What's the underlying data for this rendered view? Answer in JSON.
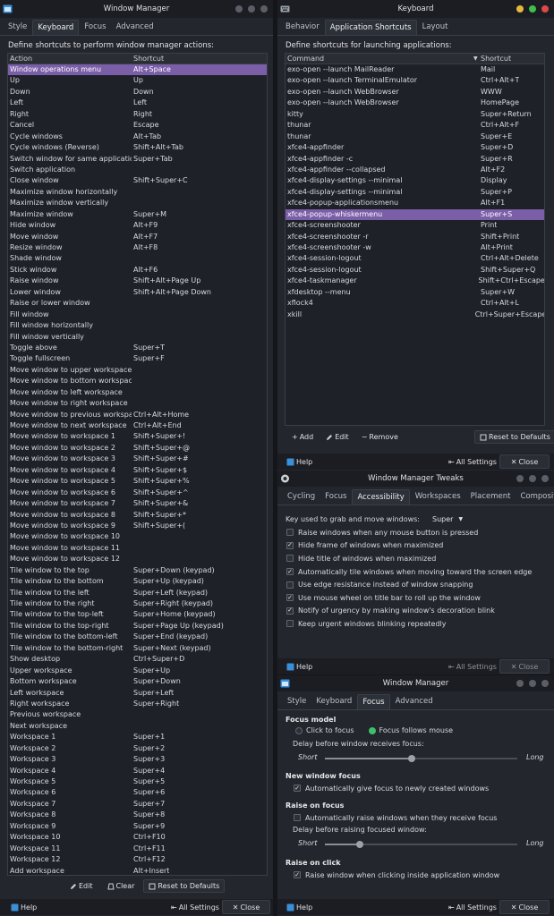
{
  "wm1": {
    "title": "Window Manager",
    "tabs": [
      "Style",
      "Keyboard",
      "Focus",
      "Advanced"
    ],
    "active_tab": 1,
    "description": "Define shortcuts to perform window manager actions:",
    "col_action": "Action",
    "col_shortcut": "Shortcut",
    "rows": [
      [
        "Window operations menu",
        "Alt+Space"
      ],
      [
        "Up",
        "Up"
      ],
      [
        "Down",
        "Down"
      ],
      [
        "Left",
        "Left"
      ],
      [
        "Right",
        "Right"
      ],
      [
        "Cancel",
        "Escape"
      ],
      [
        "Cycle windows",
        "Alt+Tab"
      ],
      [
        "Cycle windows (Reverse)",
        "Shift+Alt+Tab"
      ],
      [
        "Switch window for same application",
        "Super+Tab"
      ],
      [
        "Switch application",
        ""
      ],
      [
        "Close window",
        "Shift+Super+C"
      ],
      [
        "Maximize window horizontally",
        ""
      ],
      [
        "Maximize window vertically",
        ""
      ],
      [
        "Maximize window",
        "Super+M"
      ],
      [
        "Hide window",
        "Alt+F9"
      ],
      [
        "Move window",
        "Alt+F7"
      ],
      [
        "Resize window",
        "Alt+F8"
      ],
      [
        "Shade window",
        ""
      ],
      [
        "Stick window",
        "Alt+F6"
      ],
      [
        "Raise window",
        "Shift+Alt+Page Up"
      ],
      [
        "Lower window",
        "Shift+Alt+Page Down"
      ],
      [
        "Raise or lower window",
        ""
      ],
      [
        "Fill window",
        ""
      ],
      [
        "Fill window horizontally",
        ""
      ],
      [
        "Fill window vertically",
        ""
      ],
      [
        "Toggle above",
        "Super+T"
      ],
      [
        "Toggle fullscreen",
        "Super+F"
      ],
      [
        "Move window to upper workspace",
        ""
      ],
      [
        "Move window to bottom workspace",
        ""
      ],
      [
        "Move window to left workspace",
        ""
      ],
      [
        "Move window to right workspace",
        ""
      ],
      [
        "Move window to previous workspace",
        "Ctrl+Alt+Home"
      ],
      [
        "Move window to next workspace",
        "Ctrl+Alt+End"
      ],
      [
        "Move window to workspace 1",
        "Shift+Super+!"
      ],
      [
        "Move window to workspace 2",
        "Shift+Super+@"
      ],
      [
        "Move window to workspace 3",
        "Shift+Super+#"
      ],
      [
        "Move window to workspace 4",
        "Shift+Super+$"
      ],
      [
        "Move window to workspace 5",
        "Shift+Super+%"
      ],
      [
        "Move window to workspace 6",
        "Shift+Super+^"
      ],
      [
        "Move window to workspace 7",
        "Shift+Super+&"
      ],
      [
        "Move window to workspace 8",
        "Shift+Super+*"
      ],
      [
        "Move window to workspace 9",
        "Shift+Super+("
      ],
      [
        "Move window to workspace 10",
        ""
      ],
      [
        "Move window to workspace 11",
        ""
      ],
      [
        "Move window to workspace 12",
        ""
      ],
      [
        "Tile window to the top",
        "Super+Down (keypad)"
      ],
      [
        "Tile window to the bottom",
        "Super+Up (keypad)"
      ],
      [
        "Tile window to the left",
        "Super+Left (keypad)"
      ],
      [
        "Tile window to the right",
        "Super+Right (keypad)"
      ],
      [
        "Tile window to the top-left",
        "Super+Home (keypad)"
      ],
      [
        "Tile window to the top-right",
        "Super+Page Up (keypad)"
      ],
      [
        "Tile window to the bottom-left",
        "Super+End (keypad)"
      ],
      [
        "Tile window to the bottom-right",
        "Super+Next (keypad)"
      ],
      [
        "Show desktop",
        "Ctrl+Super+D"
      ],
      [
        "Upper workspace",
        "Super+Up"
      ],
      [
        "Bottom workspace",
        "Super+Down"
      ],
      [
        "Left workspace",
        "Super+Left"
      ],
      [
        "Right workspace",
        "Super+Right"
      ],
      [
        "Previous workspace",
        ""
      ],
      [
        "Next workspace",
        ""
      ],
      [
        "Workspace 1",
        "Super+1"
      ],
      [
        "Workspace 2",
        "Super+2"
      ],
      [
        "Workspace 3",
        "Super+3"
      ],
      [
        "Workspace 4",
        "Super+4"
      ],
      [
        "Workspace 5",
        "Super+5"
      ],
      [
        "Workspace 6",
        "Super+6"
      ],
      [
        "Workspace 7",
        "Super+7"
      ],
      [
        "Workspace 8",
        "Super+8"
      ],
      [
        "Workspace 9",
        "Super+9"
      ],
      [
        "Workspace 10",
        "Ctrl+F10"
      ],
      [
        "Workspace 11",
        "Ctrl+F11"
      ],
      [
        "Workspace 12",
        "Ctrl+F12"
      ],
      [
        "Add workspace",
        "Alt+Insert"
      ]
    ],
    "edit_label": "Edit",
    "clear_label": "Clear",
    "reset_label": "Reset to Defaults",
    "help_label": "Help",
    "all_settings_label": "All Settings",
    "close_label": "Close"
  },
  "kb": {
    "title": "Keyboard",
    "tabs": [
      "Behavior",
      "Application Shortcuts",
      "Layout"
    ],
    "active_tab": 1,
    "description": "Define shortcuts for launching applications:",
    "col_command": "Command",
    "col_shortcut": "Shortcut",
    "rows": [
      [
        "exo-open --launch MailReader",
        "Mail"
      ],
      [
        "exo-open --launch TerminalEmulator",
        "Ctrl+Alt+T"
      ],
      [
        "exo-open --launch WebBrowser",
        "WWW"
      ],
      [
        "exo-open --launch WebBrowser",
        "HomePage"
      ],
      [
        "kitty",
        "Super+Return"
      ],
      [
        "thunar",
        "Ctrl+Alt+F"
      ],
      [
        "thunar",
        "Super+E"
      ],
      [
        "xfce4-appfinder",
        "Super+D"
      ],
      [
        "xfce4-appfinder -c",
        "Super+R"
      ],
      [
        "xfce4-appfinder --collapsed",
        "Alt+F2"
      ],
      [
        "xfce4-display-settings --minimal",
        "Display"
      ],
      [
        "xfce4-display-settings --minimal",
        "Super+P"
      ],
      [
        "xfce4-popup-applicationsmenu",
        "Alt+F1"
      ],
      [
        "xfce4-popup-whiskermenu",
        "Super+S"
      ],
      [
        "xfce4-screenshooter",
        "Print"
      ],
      [
        "xfce4-screenshooter -r",
        "Shift+Print"
      ],
      [
        "xfce4-screenshooter -w",
        "Alt+Print"
      ],
      [
        "xfce4-session-logout",
        "Ctrl+Alt+Delete"
      ],
      [
        "xfce4-session-logout",
        "Shift+Super+Q"
      ],
      [
        "xfce4-taskmanager",
        "Shift+Ctrl+Escape"
      ],
      [
        "xfdesktop --menu",
        "Super+W"
      ],
      [
        "xflock4",
        "Ctrl+Alt+L"
      ],
      [
        "xkill",
        "Ctrl+Super+Escape"
      ]
    ],
    "selected_row": 13,
    "add_label": "Add",
    "edit_label": "Edit",
    "remove_label": "Remove",
    "reset_label": "Reset to Defaults",
    "help_label": "Help",
    "all_settings_label": "All Settings",
    "close_label": "Close"
  },
  "tweaks": {
    "title": "Window Manager Tweaks",
    "tabs": [
      "Cycling",
      "Focus",
      "Accessibility",
      "Workspaces",
      "Placement",
      "Compositor"
    ],
    "active_tab": 2,
    "key_label": "Key used to grab and move windows:",
    "key_value": "Super",
    "options": [
      {
        "label": "Raise windows when any mouse button is pressed",
        "checked": false
      },
      {
        "label": "Hide frame of windows when maximized",
        "checked": true
      },
      {
        "label": "Hide title of windows when maximized",
        "checked": false
      },
      {
        "label": "Automatically tile windows when moving toward the screen edge",
        "checked": true
      },
      {
        "label": "Use edge resistance instead of window snapping",
        "checked": false
      },
      {
        "label": "Use mouse wheel on title bar to roll up the window",
        "checked": true
      },
      {
        "label": "Notify of urgency by making window's decoration blink",
        "checked": true
      },
      {
        "label": "Keep urgent windows blinking repeatedly",
        "checked": false
      }
    ],
    "help_label": "Help",
    "all_settings_label": "All Settings",
    "close_label": "Close"
  },
  "wm2": {
    "title": "Window Manager",
    "tabs": [
      "Style",
      "Keyboard",
      "Focus",
      "Advanced"
    ],
    "active_tab": 2,
    "focus_model": "Focus model",
    "click_to_focus": "Click to focus",
    "focus_follows_mouse": "Focus follows mouse",
    "focus_follows_selected": true,
    "delay_label": "Delay before window receives focus:",
    "short_label": "Short",
    "long_label": "Long",
    "focus_delay_fraction": 0.45,
    "new_focus": "New window focus",
    "new_focus_opt": "Automatically give focus to newly created windows",
    "raise_focus": "Raise on focus",
    "raise_focus_opt": "Automatically raise windows when they receive focus",
    "raise_delay_label": "Delay before raising focused window:",
    "raise_delay_fraction": 0.18,
    "raise_click": "Raise on click",
    "raise_click_opt": "Raise window when clicking inside application window",
    "help_label": "Help",
    "all_settings_label": "All Settings",
    "close_label": "Close"
  }
}
